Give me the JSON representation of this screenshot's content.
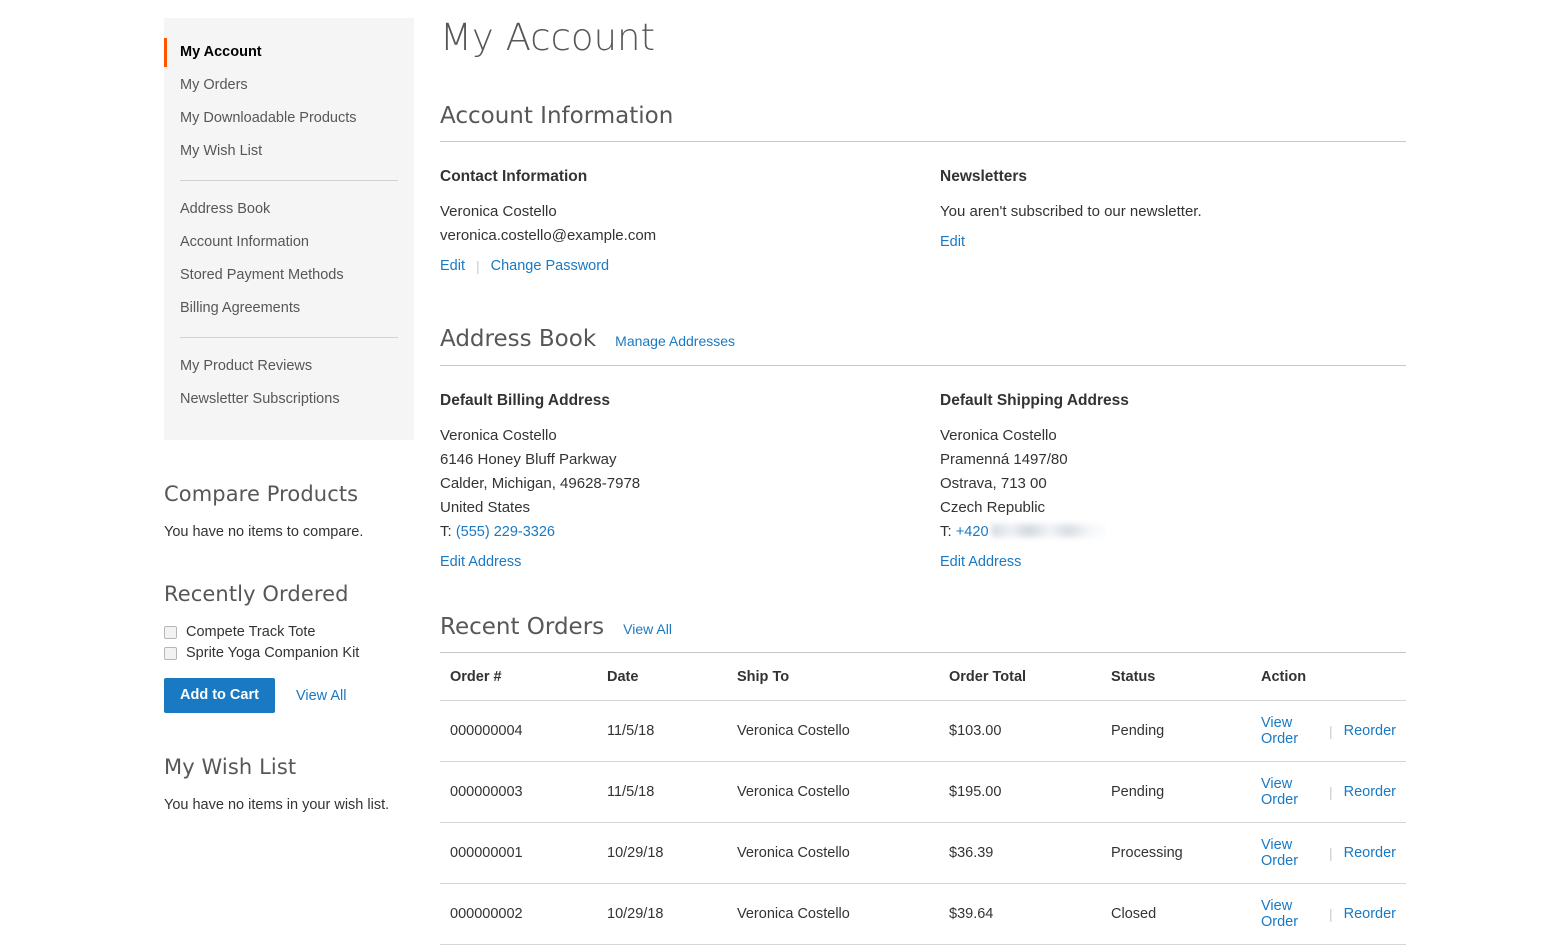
{
  "page": {
    "title": "My Account"
  },
  "sidebar": {
    "nav_groups": [
      {
        "items": [
          {
            "label": "My Account",
            "current": true
          },
          {
            "label": "My Orders",
            "current": false
          },
          {
            "label": "My Downloadable Products",
            "current": false
          },
          {
            "label": "My Wish List",
            "current": false
          }
        ]
      },
      {
        "items": [
          {
            "label": "Address Book",
            "current": false
          },
          {
            "label": "Account Information",
            "current": false
          },
          {
            "label": "Stored Payment Methods",
            "current": false
          },
          {
            "label": "Billing Agreements",
            "current": false
          }
        ]
      },
      {
        "items": [
          {
            "label": "My Product Reviews",
            "current": false
          },
          {
            "label": "Newsletter Subscriptions",
            "current": false
          }
        ]
      }
    ],
    "compare": {
      "title": "Compare Products",
      "empty_text": "You have no items to compare."
    },
    "recently_ordered": {
      "title": "Recently Ordered",
      "items": [
        {
          "label": "Compete Track Tote",
          "checked": false
        },
        {
          "label": "Sprite Yoga Companion Kit",
          "checked": false
        }
      ],
      "add_to_cart_label": "Add to Cart",
      "view_all_label": "View All"
    },
    "wish_list": {
      "title": "My Wish List",
      "empty_text": "You have no items in your wish list."
    }
  },
  "account_information": {
    "title": "Account Information",
    "contact": {
      "title": "Contact Information",
      "name": "Veronica Costello",
      "email": "veronica.costello@example.com",
      "edit_label": "Edit",
      "separator": "|",
      "change_password_label": "Change Password"
    },
    "newsletters": {
      "title": "Newsletters",
      "status_text": "You aren't subscribed to our newsletter.",
      "edit_label": "Edit"
    }
  },
  "address_book": {
    "title": "Address Book",
    "manage_label": "Manage Addresses",
    "billing": {
      "title": "Default Billing Address",
      "name": "Veronica Costello",
      "street": "6146 Honey Bluff Parkway",
      "city_region_zip": "Calder, Michigan, 49628-7978",
      "country": "United States",
      "phone_prefix": "T: ",
      "phone": "(555) 229-3326",
      "edit_label": "Edit Address"
    },
    "shipping": {
      "title": "Default Shipping Address",
      "name": "Veronica Costello",
      "street": "Pramenná 1497/80",
      "city_region_zip": "Ostrava, 713 00",
      "country": "Czech Republic",
      "phone_prefix": "T: ",
      "phone": "+420",
      "phone_redacted": true,
      "edit_label": "Edit Address"
    }
  },
  "recent_orders": {
    "title": "Recent Orders",
    "view_all_label": "View All",
    "columns": [
      "Order #",
      "Date",
      "Ship To",
      "Order Total",
      "Status",
      "Action"
    ],
    "rows": [
      {
        "order": "000000004",
        "date": "11/5/18",
        "ship_to": "Veronica Costello",
        "total": "$103.00",
        "status": "Pending",
        "view_label": "View Order",
        "separator": "|",
        "reorder_label": "Reorder"
      },
      {
        "order": "000000003",
        "date": "11/5/18",
        "ship_to": "Veronica Costello",
        "total": "$195.00",
        "status": "Pending",
        "view_label": "View Order",
        "separator": "|",
        "reorder_label": "Reorder"
      },
      {
        "order": "000000001",
        "date": "10/29/18",
        "ship_to": "Veronica Costello",
        "total": "$36.39",
        "status": "Processing",
        "view_label": "View Order",
        "separator": "|",
        "reorder_label": "Reorder"
      },
      {
        "order": "000000002",
        "date": "10/29/18",
        "ship_to": "Veronica Costello",
        "total": "$39.64",
        "status": "Closed",
        "view_label": "View Order",
        "separator": "|",
        "reorder_label": "Reorder"
      }
    ]
  },
  "colors": {
    "accent_orange": "#ff5501",
    "link_blue": "#1979c3",
    "button_blue": "#1979c3",
    "sidebar_bg": "#f5f5f5",
    "text": "#333333",
    "muted_text": "#575757",
    "border": "#d6d6d6"
  }
}
